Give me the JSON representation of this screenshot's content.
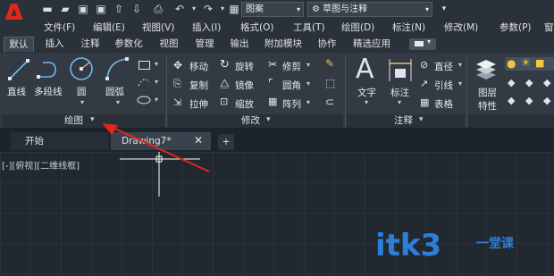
{
  "quick_access": {
    "workspace_value": "草图与注释",
    "layer_value": "图案",
    "icons": [
      "new-file-icon",
      "open-folder-icon",
      "save-icon",
      "save-as-icon",
      "upload-icon",
      "download-icon",
      "print-icon",
      "undo-icon",
      "redo-icon",
      "match-properties-icon"
    ]
  },
  "menu_items": [
    "文件(F)",
    "编辑(E)",
    "视图(V)",
    "插入(I)",
    "格式(O)",
    "工具(T)",
    "绘图(D)",
    "标注(N)",
    "修改(M)",
    "参数(P)",
    "窗"
  ],
  "ribbon_tabs": [
    "默认",
    "插入",
    "注释",
    "参数化",
    "视图",
    "管理",
    "输出",
    "附加模块",
    "协作",
    "精选应用"
  ],
  "draw_panel": {
    "line": "直线",
    "polyline": "多段线",
    "circle": "圆",
    "arc": "圆弧",
    "label": "绘图"
  },
  "modify_panel": {
    "move": "移动",
    "rotate": "旋转",
    "trim": "修剪",
    "copy": "复制",
    "mirror": "镜像",
    "fillet": "圆角",
    "stretch": "拉伸",
    "scale": "缩放",
    "array": "阵列",
    "label": "修改"
  },
  "annotation_panel": {
    "text": "文字",
    "dimension": "标注",
    "linear": "直径",
    "leader": "引线",
    "table": "表格",
    "label": "注释"
  },
  "layers_panel": {
    "layer_properties_line1": "图层",
    "layer_properties_line2": "特性"
  },
  "doc_tabs": {
    "start": "开始",
    "drawing": "Drawing7*",
    "add": "+"
  },
  "viewport_label": "[-][俯视][二维线框]",
  "watermark": {
    "main": "itk3",
    "side": "一堂课"
  },
  "colors": {
    "accent_red": "#e0261d",
    "watermark_blue": "#2c7fd6"
  }
}
